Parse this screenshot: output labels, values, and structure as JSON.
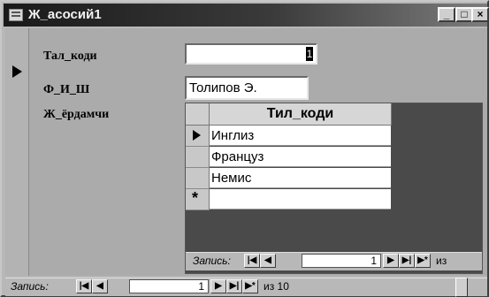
{
  "window": {
    "title": "Ж_асосий1",
    "minimize": "_",
    "maximize": "□",
    "close": "×"
  },
  "fields": {
    "tal_kodi_label": "Тал_коди",
    "tal_kodi_value": "1",
    "fish_label": "Ф_И_Ш",
    "fish_value": "Толипов Э.",
    "yordamchi_label": "Ж_ёрдамчи"
  },
  "subform": {
    "column_header": "Тил_коди",
    "rows": [
      "Инглиз",
      "Француз",
      "Немис"
    ],
    "new_row_marker": "*",
    "nav": {
      "label": "Запись:",
      "first": "|◀",
      "prev": "◀",
      "current": "1",
      "next": "▶",
      "last": "▶|",
      "new": "▶*",
      "of_text": "из"
    }
  },
  "main_nav": {
    "label": "Запись:",
    "first": "|◀",
    "prev": "◀",
    "current": "1",
    "next": "▶",
    "last": "▶|",
    "new": "▶*",
    "of_text": "из 10"
  }
}
